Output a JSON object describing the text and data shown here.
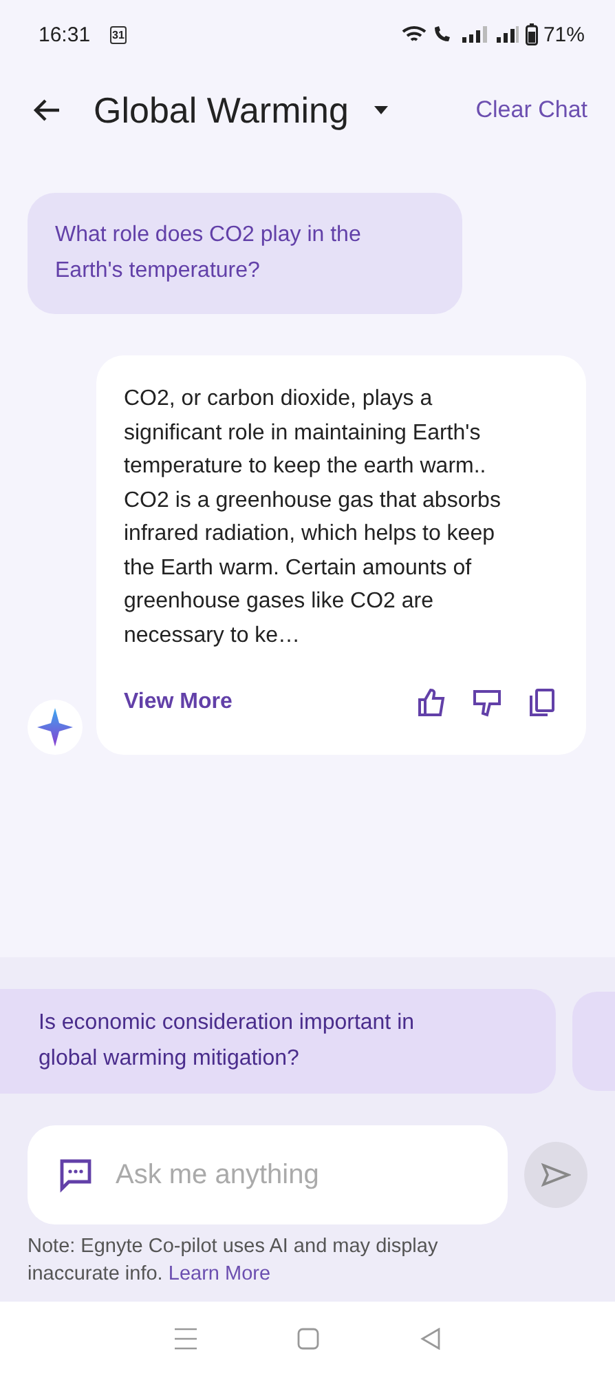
{
  "status_bar": {
    "time": "16:31",
    "calendar_day": "31",
    "battery": "71%"
  },
  "header": {
    "title": "Global Warming",
    "action": "Clear Chat"
  },
  "messages": [
    {
      "kind": "user",
      "text": "What role does CO2 play in the Earth's temperature?"
    },
    {
      "kind": "bot",
      "text": "CO2, or carbon dioxide, plays a significant role in maintaining Earth's temperature  to keep the earth warm.. CO2 is a greenhouse gas that absorbs infrared radiation, which helps to keep the Earth warm. Certain amounts of greenhouse gases like CO2 are necessary to ke…",
      "link": "View More"
    }
  ],
  "suggestions": [
    {
      "text": "Is economic consideration important in global warming mitigation?"
    }
  ],
  "composer": {
    "placeholder": "Ask me anything"
  },
  "note": {
    "text": "Note: Egnyte Co-pilot uses AI and may display inaccurate info.",
    "link": "Learn More"
  }
}
